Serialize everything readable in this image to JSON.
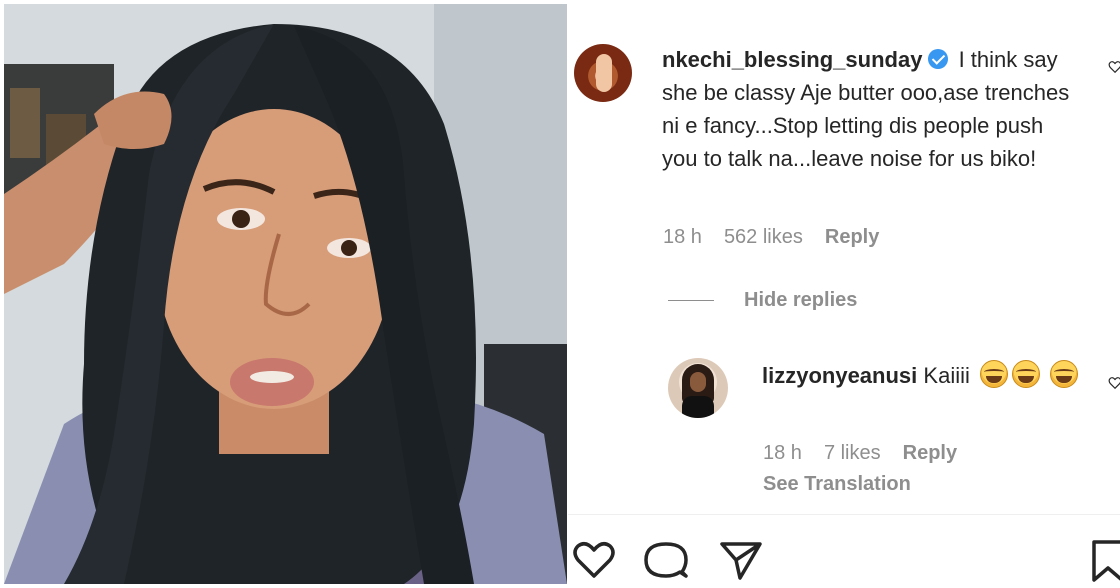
{
  "comment": {
    "username": "nkechi_blessing_sunday",
    "text": "I think say she be classy Aje butter ooo,ase trenches ni e fancy...Stop letting dis people push you to talk na...leave noise for us biko!",
    "time": "18 h",
    "likes": "562 likes",
    "reply_label": "Reply"
  },
  "hide_replies_label": "Hide replies",
  "reply": {
    "username": "lizzyonyeanusi",
    "text": "Kaiiii",
    "emoji": "joy-emoji",
    "time": "18 h",
    "likes": "7 likes",
    "reply_label": "Reply",
    "see_translation": "See Translation"
  },
  "icons": {
    "like": "heart-icon",
    "comment": "comment-icon",
    "share": "paper-plane-icon",
    "save": "bookmark-icon"
  },
  "colors": {
    "text": "#262626",
    "muted": "#8e8e8e",
    "verified": "#3897f0"
  }
}
